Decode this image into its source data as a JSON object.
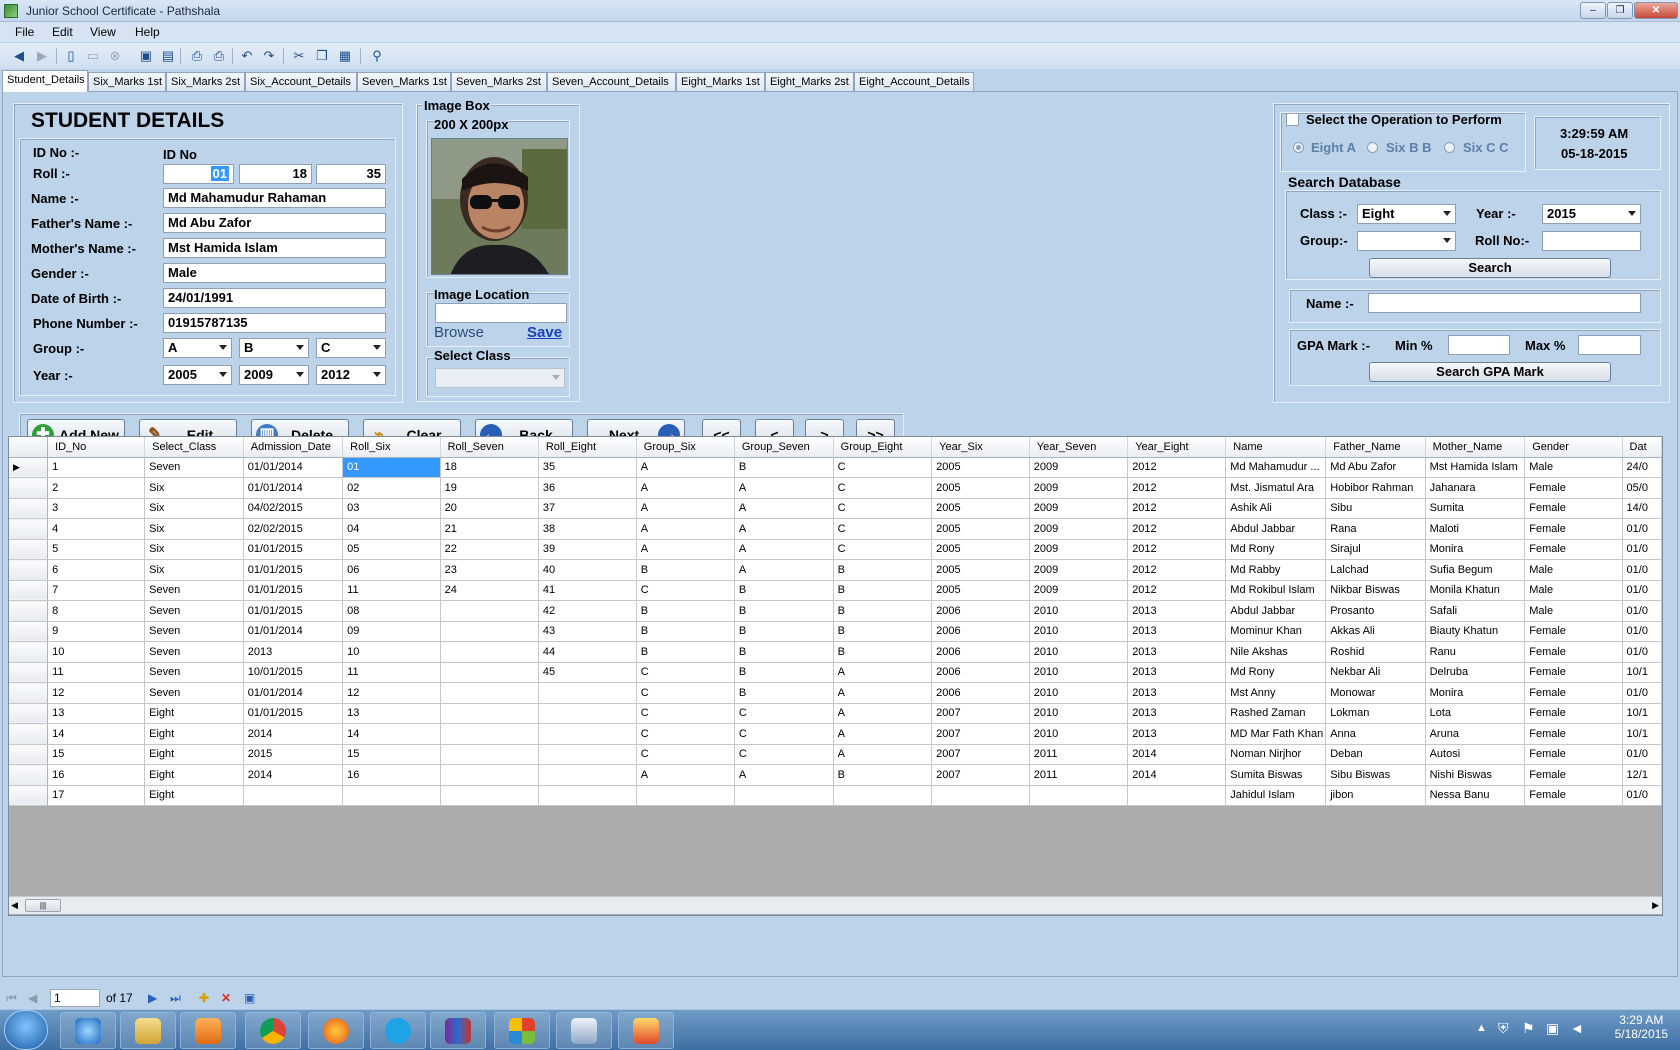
{
  "window": {
    "title": "Junior School Certificate - Pathshala",
    "minimize": "‒",
    "maximize": "❐",
    "close": "✕"
  },
  "menu": [
    "File",
    "Edit",
    "View",
    "Help"
  ],
  "tabs": [
    "Student_Details",
    "Six_Marks 1st",
    "Six_Marks 2st",
    "Six_Account_Details",
    "Seven_Marks 1st",
    "Seven_Marks 2st",
    "Seven_Account_Details",
    "Eight_Marks 1st",
    "Eight_Marks 2st",
    "Eight_Account_Details"
  ],
  "student": {
    "heading": "STUDENT DETAILS",
    "id_label": "ID No :-",
    "id_value": "ID No",
    "roll_label": "Roll :-",
    "roll": [
      "01",
      "18",
      "35"
    ],
    "name_label": "Name :-",
    "name": "Md Mahamudur Rahaman",
    "father_label": "Father's Name :-",
    "father": "Md Abu Zafor",
    "mother_label": "Mother's Name :-",
    "mother": "Mst Hamida Islam",
    "gender_label": "Gender  :-",
    "gender": "Male",
    "dob_label": "Date of Birth  :-",
    "dob": "24/01/1991",
    "phone_label": "Phone Number :-",
    "phone": "01915787135",
    "group_label": "Group :-",
    "group": [
      "A",
      "B",
      "C"
    ],
    "year_label": "Year :-",
    "year": [
      "2005",
      "2009",
      "2012"
    ]
  },
  "image_box": {
    "title": "Image Box",
    "size": "200 X 200px",
    "location_label": "Image Location",
    "browse": "Browse",
    "save": "Save",
    "select_class": "Select Class"
  },
  "operation": {
    "title": "Select the Operation to Perform",
    "options": [
      "Eight A",
      "Six B B",
      "Six C C"
    ],
    "time": "3:29:59 AM",
    "date": "05-18-2015"
  },
  "search": {
    "title": "Search Database",
    "class_label": "Class :-",
    "class_value": "Eight",
    "year_label": "Year :-",
    "year_value": "2015",
    "group_label": "Group:-",
    "roll_label": "Roll No:-",
    "search_button": "Search",
    "name_label": "Name :-",
    "gpa_label": "GPA Mark :-",
    "min_label": "Min %",
    "max_label": "Max %",
    "gpa_button": "Search GPA Mark"
  },
  "actions": [
    "Add New",
    "Edit",
    "Delete",
    "Clear",
    "Back",
    "Next",
    "<<",
    "<",
    ">",
    ">>"
  ],
  "grid": {
    "columns": [
      "ID_No",
      "Select_Class",
      "Admission_Date",
      "Roll_Six",
      "Roll_Seven",
      "Roll_Eight",
      "Group_Six",
      "Group_Seven",
      "Group_Eight",
      "Year_Six",
      "Year_Seven",
      "Year_Eight",
      "Name",
      "Father_Name",
      "Mother_Name",
      "Gender",
      "Dat"
    ],
    "rows": [
      [
        "1",
        "Seven",
        "01/01/2014",
        "01",
        "18",
        "35",
        "A",
        "B",
        "C",
        "2005",
        "2009",
        "2012",
        "Md Mahamudur ...",
        "Md Abu Zafor",
        "Mst Hamida Islam",
        "Male",
        "24/0"
      ],
      [
        "2",
        "Six",
        "01/01/2014",
        "02",
        "19",
        "36",
        "A",
        "A",
        "C",
        "2005",
        "2009",
        "2012",
        "Mst. Jismatul Ara",
        "Hobibor Rahman",
        "Jahanara",
        "Female",
        "05/0"
      ],
      [
        "3",
        "Six",
        "04/02/2015",
        "03",
        "20",
        "37",
        "A",
        "A",
        "C",
        "2005",
        "2009",
        "2012",
        "Ashik Ali",
        "Sibu",
        "Sumita",
        "Female",
        "14/0"
      ],
      [
        "4",
        "Six",
        "02/02/2015",
        "04",
        "21",
        "38",
        "A",
        "A",
        "C",
        "2005",
        "2009",
        "2012",
        "Abdul Jabbar",
        "Rana",
        "Maloti",
        "Female",
        "01/0"
      ],
      [
        "5",
        "Six",
        "01/01/2015",
        "05",
        "22",
        "39",
        "A",
        "A",
        "C",
        "2005",
        "2009",
        "2012",
        "Md Rony",
        "Sirajul",
        "Monira",
        "Female",
        "01/0"
      ],
      [
        "6",
        "Six",
        "01/01/2015",
        "06",
        "23",
        "40",
        "B",
        "A",
        "B",
        "2005",
        "2009",
        "2012",
        "Md Rabby",
        "Lalchad",
        "Sufia Begum",
        "Male",
        "01/0"
      ],
      [
        "7",
        "Seven",
        "01/01/2015",
        "11",
        "24",
        "41",
        "C",
        "B",
        "B",
        "2005",
        "2009",
        "2012",
        "Md Rokibul Islam",
        "Nikbar Biswas",
        "Monila Khatun",
        "Male",
        "01/0"
      ],
      [
        "8",
        "Seven",
        "01/01/2015",
        "08",
        "",
        "42",
        "B",
        "B",
        "B",
        "2006",
        "2010",
        "2013",
        "Abdul Jabbar",
        "Prosanto",
        "Safali",
        "Male",
        "01/0"
      ],
      [
        "9",
        "Seven",
        "01/01/2014",
        "09",
        "",
        "43",
        "B",
        "B",
        "B",
        "2006",
        "2010",
        "2013",
        "Mominur Khan",
        "Akkas Ali",
        "Biauty Khatun",
        "Female",
        "01/0"
      ],
      [
        "10",
        "Seven",
        "2013",
        "10",
        "",
        "44",
        "B",
        "B",
        "B",
        "2006",
        "2010",
        "2013",
        "Nile Akshas",
        "Roshid",
        "Ranu",
        "Female",
        "01/0"
      ],
      [
        "11",
        "Seven",
        "10/01/2015",
        "11",
        "",
        "45",
        "C",
        "B",
        "A",
        "2006",
        "2010",
        "2013",
        "Md Rony",
        "Nekbar Ali",
        "Delruba",
        "Female",
        "10/1"
      ],
      [
        "12",
        "Seven",
        "01/01/2014",
        "12",
        "",
        "",
        "C",
        "B",
        "A",
        "2006",
        "2010",
        "2013",
        "Mst Anny",
        "Monowar",
        "Monira",
        "Female",
        "01/0"
      ],
      [
        "13",
        "Eight",
        "01/01/2015",
        "13",
        "",
        "",
        "C",
        "C",
        "A",
        "2007",
        "2010",
        "2013",
        "Rashed Zaman",
        "Lokman",
        "Lota",
        "Female",
        "10/1"
      ],
      [
        "14",
        "Eight",
        "2014",
        "14",
        "",
        "",
        "C",
        "C",
        "A",
        "2007",
        "2010",
        "2013",
        "MD Mar Fath Khan",
        "Anna",
        "Aruna",
        "Female",
        "10/1"
      ],
      [
        "15",
        "Eight",
        "2015",
        "15",
        "",
        "",
        "C",
        "C",
        "A",
        "2007",
        "2011",
        "2014",
        "Noman Nirjhor",
        "Deban",
        "Autosi",
        "Female",
        "01/0"
      ],
      [
        "16",
        "Eight",
        "2014",
        "16",
        "",
        "",
        "A",
        "A",
        "B",
        "2007",
        "2011",
        "2014",
        "Sumita Biswas",
        "Sibu Biswas",
        "Nishi Biswas",
        "Female",
        "12/1"
      ],
      [
        "17",
        "Eight",
        "",
        "",
        "",
        "",
        "",
        "",
        "",
        "",
        "",
        "",
        "Jahidul Islam",
        "jibon",
        "Nessa Banu",
        "Female",
        "01/0"
      ]
    ]
  },
  "navigator": {
    "position": "1",
    "count": "of 17"
  },
  "taskbar": {
    "time": "3:29 AM",
    "date": "5/18/2015"
  },
  "colors": {
    "form_bg": "#bcd3ea",
    "selection": "#3399ff",
    "link": "#1a3fbf"
  }
}
